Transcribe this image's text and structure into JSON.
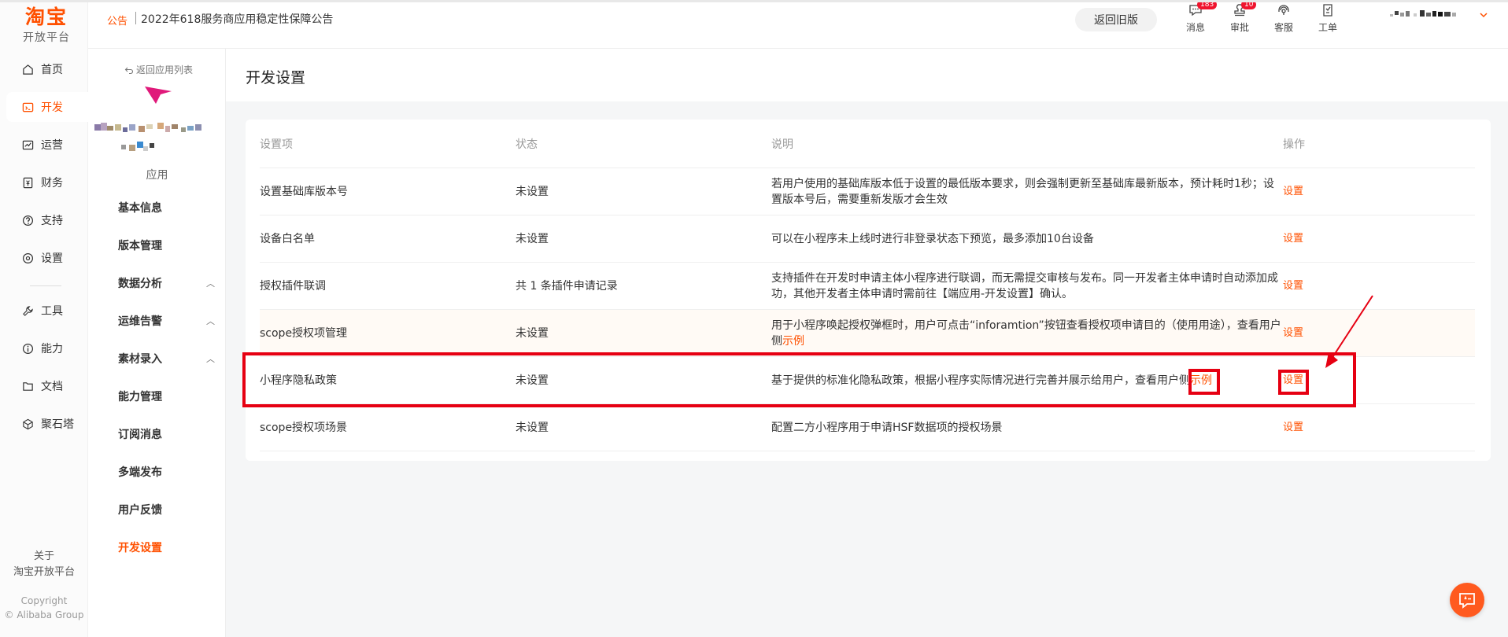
{
  "brand": {
    "name": "淘宝",
    "subtitle": "开放平台"
  },
  "rail": {
    "items": [
      {
        "label": "首页",
        "icon": "home-icon"
      },
      {
        "label": "开发",
        "icon": "code-icon",
        "active": true
      },
      {
        "label": "运营",
        "icon": "chart-icon"
      },
      {
        "label": "财务",
        "icon": "wallet-icon"
      },
      {
        "label": "支持",
        "icon": "support-icon"
      },
      {
        "label": "设置",
        "icon": "gear-icon"
      },
      {
        "label": "工具",
        "icon": "wrench-icon"
      },
      {
        "label": "能力",
        "icon": "info-icon"
      },
      {
        "label": "文档",
        "icon": "doc-icon"
      },
      {
        "label": "聚石塔",
        "icon": "cube-icon"
      }
    ],
    "about_line1": "关于",
    "about_line2": "淘宝开放平台",
    "copyright_line1": "Copyright",
    "copyright_line2": "© Alibaba Group"
  },
  "header": {
    "notice_tag": "公告",
    "notice_text": "2022年618服务商应用稳定性保障公告",
    "old_version_button": "返回旧版",
    "icons": [
      {
        "label": "消息",
        "icon": "message-icon",
        "badge": "183"
      },
      {
        "label": "审批",
        "icon": "approval-icon",
        "badge": "10"
      },
      {
        "label": "客服",
        "icon": "headset-icon"
      },
      {
        "label": "工单",
        "icon": "ticket-icon"
      }
    ]
  },
  "sidebar": {
    "back_label": "返回应用列表",
    "app_caption": "应用",
    "items": [
      {
        "label": "基本信息",
        "expandable": false
      },
      {
        "label": "版本管理",
        "expandable": false
      },
      {
        "label": "数据分析",
        "expandable": true
      },
      {
        "label": "运维告警",
        "expandable": true
      },
      {
        "label": "素材录入",
        "expandable": true
      },
      {
        "label": "能力管理",
        "expandable": false
      },
      {
        "label": "订阅消息",
        "expandable": false
      },
      {
        "label": "多端发布",
        "expandable": false
      },
      {
        "label": "用户反馈",
        "expandable": false
      },
      {
        "label": "开发设置",
        "expandable": false,
        "active": true
      }
    ]
  },
  "main": {
    "title": "开发设置",
    "table": {
      "headers": [
        "设置项",
        "状态",
        "说明",
        "操作"
      ],
      "rows": [
        {
          "name": "设置基础库版本号",
          "status": "未设置",
          "desc": "若用户使用的基础库版本低于设置的最低版本要求，则会强制更新至基础库最新版本，预计耗时1秒；设置版本号后，需要重新发版才会生效",
          "desc_link": "",
          "action": "设置"
        },
        {
          "name": "设备白名单",
          "status": "未设置",
          "desc": "可以在小程序未上线时进行非登录状态下预览，最多添加10台设备",
          "desc_link": "",
          "action": "设置"
        },
        {
          "name": "授权插件联调",
          "status": "共 1 条插件申请记录",
          "desc": "支持插件在开发时申请主体小程序进行联调，而无需提交审核与发布。同一开发者主体申请时自动添加成功，其他开发者主体申请时需前往【端应用-开发设置】确认。",
          "desc_link": "",
          "action": "设置"
        },
        {
          "name": "scope授权项管理",
          "status": "未设置",
          "desc": "用于小程序唤起授权弹框时，用户可点击“inforamtion”按钮查看授权项申请目的（使用用途），查看用户侧",
          "desc_link": "示例",
          "action": "设置"
        },
        {
          "name": "小程序隐私政策",
          "status": "未设置",
          "desc": "基于提供的标准化隐私政策，根据小程序实际情况进行完善并展示给用户，查看用户侧",
          "desc_link": "示例",
          "action": "设置"
        },
        {
          "name": "scope授权项场景",
          "status": "未设置",
          "desc": "配置二方小程序用于申请HSF数据项的授权场景",
          "desc_link": "",
          "action": "设置"
        }
      ]
    }
  },
  "colors": {
    "accent": "#ff5000",
    "annotation": "#e60012"
  }
}
